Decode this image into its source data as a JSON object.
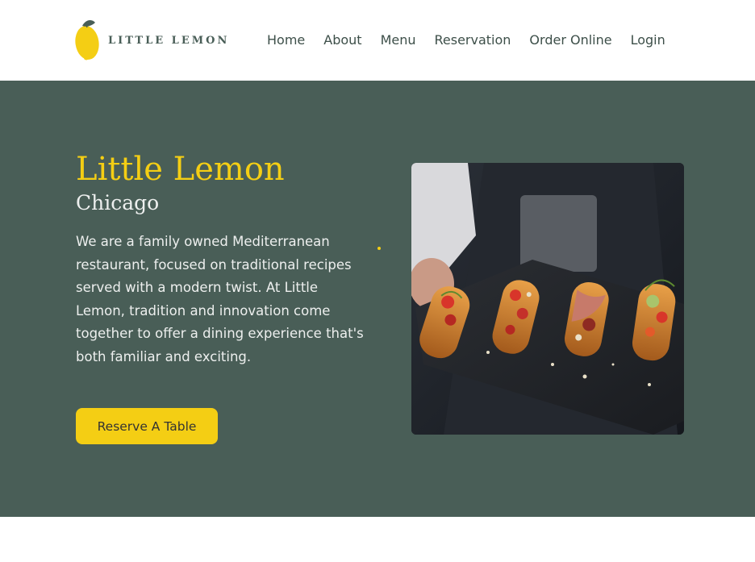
{
  "brand": {
    "name": "LITTLE LEMON",
    "colors": {
      "primary_green": "#495E57",
      "primary_yellow": "#F4CE14",
      "highlight_light": "#EDEFEE"
    }
  },
  "nav": {
    "items": [
      {
        "label": "Home"
      },
      {
        "label": "About"
      },
      {
        "label": "Menu"
      },
      {
        "label": "Reservation"
      },
      {
        "label": "Order Online"
      },
      {
        "label": "Login"
      }
    ]
  },
  "hero": {
    "title": "Little Lemon",
    "subtitle": "Chicago",
    "description": "We are a family owned Mediterranean restaurant, focused on traditional recipes served with a modern twist. At Little Lemon, tradition and innovation come together to offer a dining experience that's both familiar and exciting.",
    "cta_label": "Reserve A Table",
    "image_icon": "food-photo"
  }
}
